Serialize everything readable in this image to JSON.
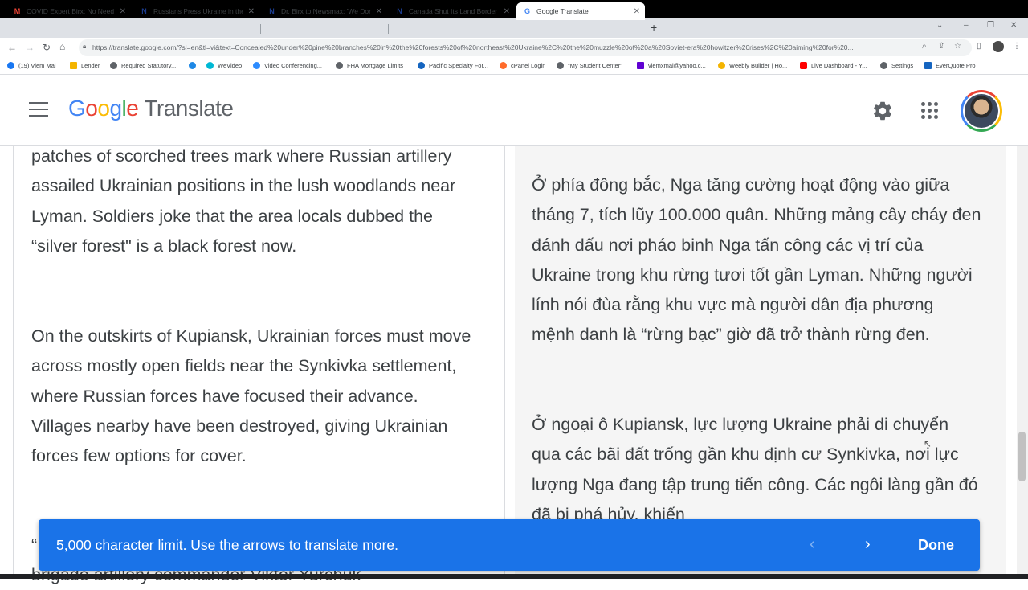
{
  "browser": {
    "tabs": [
      {
        "label": "COVID Expert Birx: No Need for",
        "favicon": "gmail-icon",
        "color": "#ea4335"
      },
      {
        "label": "Russians Press Ukraine in the No",
        "favicon": "newsmax-icon",
        "color": "#1a3a8a"
      },
      {
        "label": "Dr. Birx to Newsmax: 'We Don't N",
        "favicon": "newsmax-icon",
        "color": "#1a3a8a"
      },
      {
        "label": "Canada Shut Its Land Border to A",
        "favicon": "newsmax-icon",
        "color": "#1a3a8a"
      },
      {
        "label": "Google Translate",
        "favicon": "translate-icon",
        "color": "#4285f4"
      }
    ],
    "url": "https://translate.google.com/?sl=en&tl=vi&text=Concealed%20under%20pine%20branches%20in%20the%20forests%20of%20northeast%20Ukraine%2C%20the%20muzzle%20of%20a%20Soviet-era%20howitzer%20rises%2C%20aiming%20for%20...",
    "bookmarks": [
      {
        "label": "(19) Viem Mai",
        "color": "#1877f2"
      },
      {
        "label": "Lender",
        "color": "#f4b400"
      },
      {
        "label": "Required Statutory...",
        "color": "#5f6368"
      },
      {
        "label": "",
        "color": "#1e88e5"
      },
      {
        "label": "WeVideo",
        "color": "#00b8d4"
      },
      {
        "label": "Video Conferencing...",
        "color": "#2d8cff"
      },
      {
        "label": "FHA Mortgage Limits",
        "color": "#5f6368"
      },
      {
        "label": "Pacific Specialty For...",
        "color": "#1565c0"
      },
      {
        "label": "cPanel Login",
        "color": "#ff6c2c"
      },
      {
        "label": "\"My Student Center\"",
        "color": "#5f6368"
      },
      {
        "label": "viemxmai@yahoo.c...",
        "color": "#6001d2"
      },
      {
        "label": "Weebly Builder | Ho...",
        "color": "#f4b400"
      },
      {
        "label": "Live Dashboard - Y...",
        "color": "#ff0000"
      },
      {
        "label": "Settings",
        "color": "#5f6368"
      },
      {
        "label": "EverQuote Pro",
        "color": "#1565c0"
      }
    ]
  },
  "header": {
    "logo_google": "Google",
    "logo_translate": "Translate"
  },
  "source": {
    "paragraphs": [
      "patches of scorched trees mark where Russian artillery assailed Ukrainian positions in the lush woodlands near Lyman. Soldiers joke that the area locals dubbed the “silver forest\" is a black forest now.",
      "On the outskirts of Kupiansk, Ukrainian forces must move across mostly open fields near the Synkivka settlement, where Russian forces have focused their advance. Villages nearby have been destroyed, giving Ukrainian forces few options for cover.",
      "“",
      "brigade artillery commander Viktor Yurchuk"
    ]
  },
  "target": {
    "paragraphs": [
      "Ở phía đông bắc, Nga tăng cường hoạt động vào giữa tháng 7, tích lũy 100.000 quân. Những mảng cây cháy đen đánh dấu nơi pháo binh Nga tấn công các vị trí của Ukraine trong khu rừng tươi tốt gần Lyman. Những người lính nói đùa rằng khu vực mà người dân địa phương mệnh danh là “rừng bạc” giờ đã trở thành rừng đen.",
      "Ở ngoại ô Kupiansk, lực lượng Ukraine phải di chuyển qua các bãi đất trống gần khu định cư Synkivka, nơi lực lượng Nga đang tập trung tiến công. Các ngôi làng gần đó đã bị phá hủy, khiến"
    ]
  },
  "snackbar": {
    "message": "5,000 character limit. Use the arrows to translate more.",
    "done_label": "Done"
  }
}
